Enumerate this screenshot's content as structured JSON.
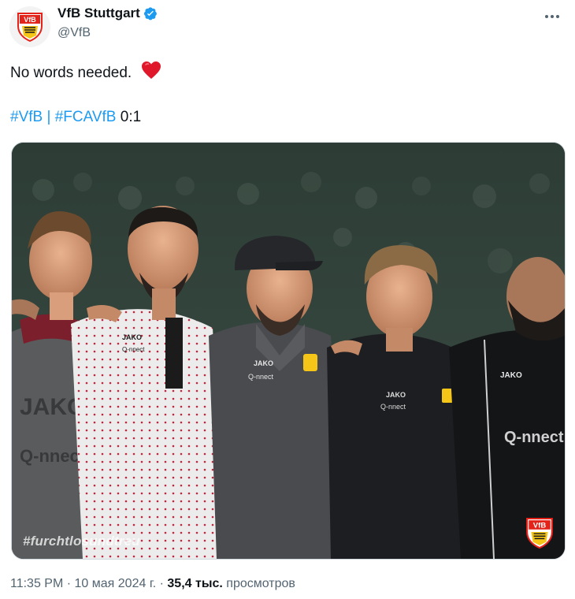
{
  "account": {
    "display_name": "VfB Stuttgart",
    "handle": "@VfB",
    "verified": true,
    "avatar_icon": "vfb-crest-icon"
  },
  "tweet": {
    "text": "No words needed.",
    "emoji": "red-heart-icon",
    "hashtag1": "#VfB",
    "separator": "|",
    "hashtag2": "#FCAVfB",
    "score": "0:1"
  },
  "media": {
    "watermark": "#furchtlosundtreu",
    "logo_text": "VfB",
    "jersey_sponsor_1": "JAKO",
    "jersey_sponsor_2": "Q-nnect"
  },
  "meta": {
    "time": "11:35 PM",
    "dot1": "·",
    "date": "10 мая 2024 г.",
    "dot2": "·",
    "views_count": "35,4 тыс.",
    "views_label": "просмотров"
  },
  "colors": {
    "link": "#1d9bf0",
    "text": "#0f1419",
    "muted": "#536471",
    "vfb_red": "#e32219"
  }
}
